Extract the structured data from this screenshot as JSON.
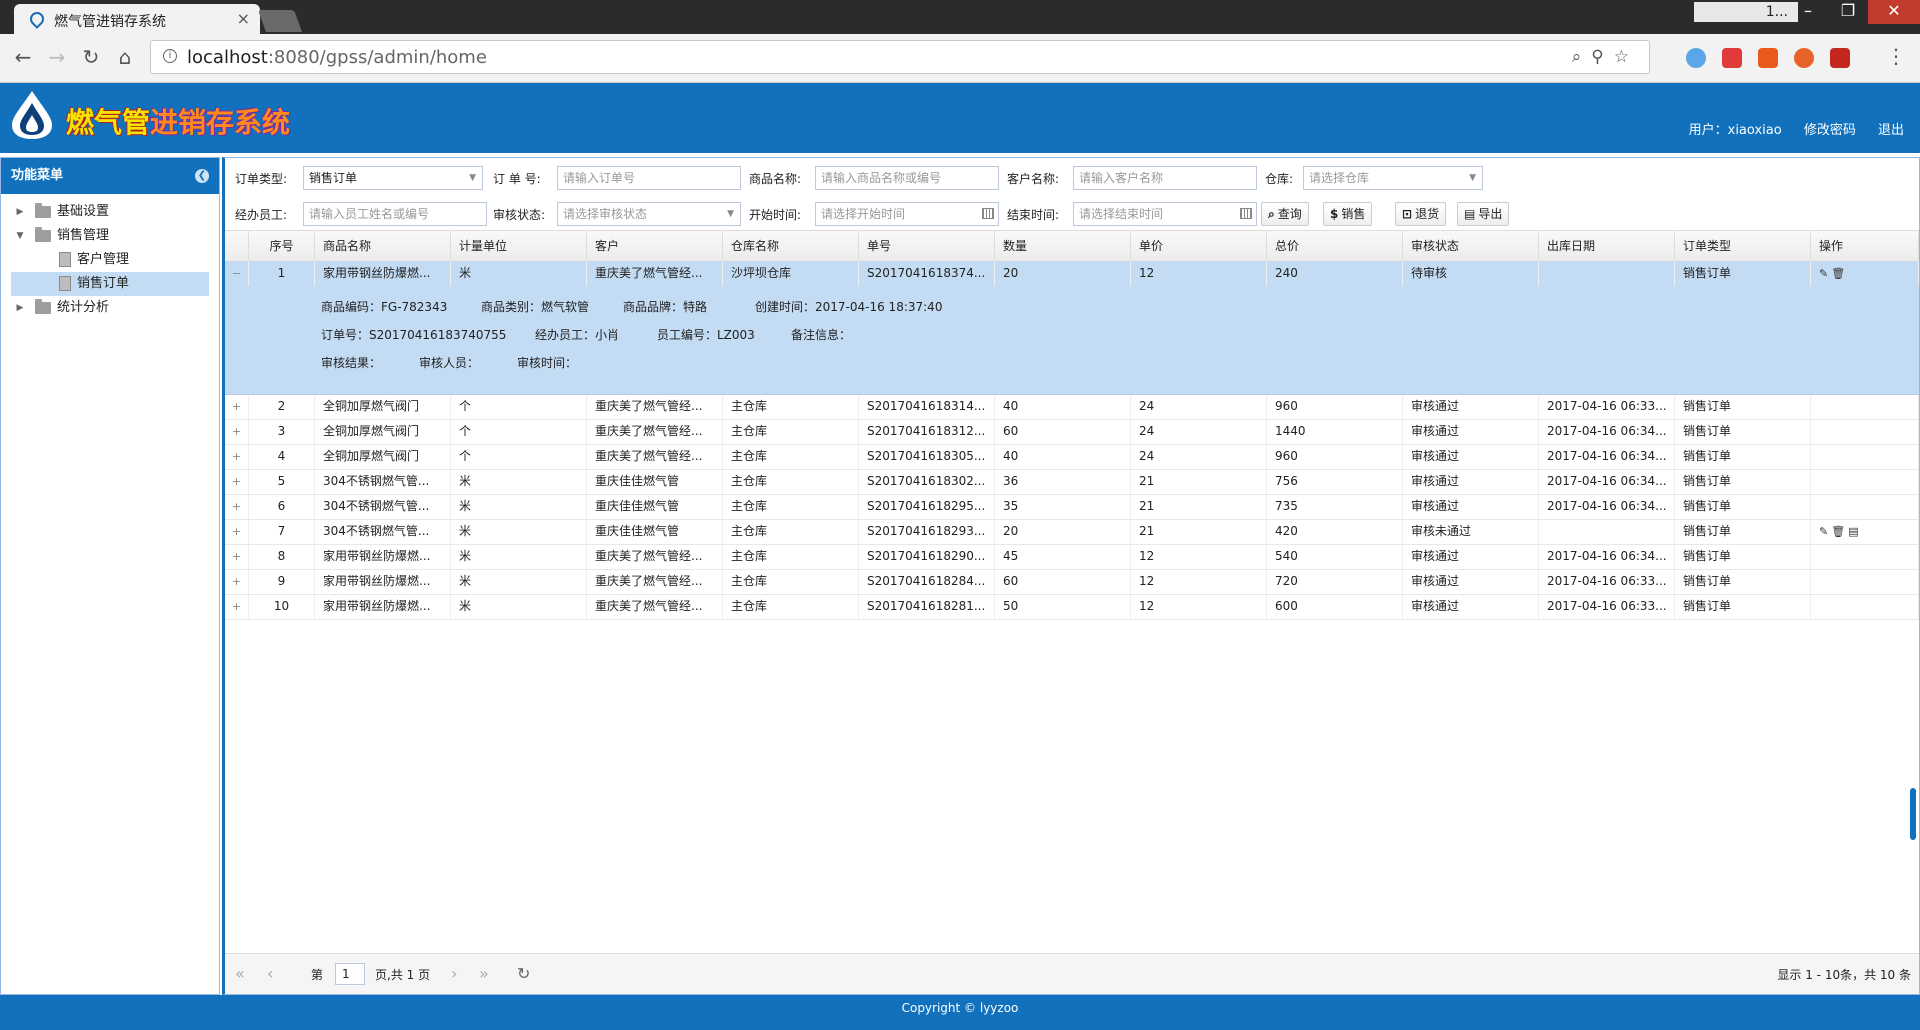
{
  "browser": {
    "tab_title": "燃气管进销存系统",
    "tab_close": "×",
    "window_name": "1...",
    "url_host": "localhost",
    "url_rest": ":8080/gpss/admin/home",
    "window_buttons": [
      "–",
      "❐",
      "✕"
    ]
  },
  "app": {
    "logo_part1": "燃气管",
    "logo_part2": "进销存系统",
    "user_label": "用户：xiaoxiao",
    "change_password": "修改密码",
    "logout": "退出"
  },
  "sidebar": {
    "title": "功能菜单",
    "items": [
      {
        "label": "基础设置"
      },
      {
        "label": "销售管理"
      },
      {
        "label": "客户管理"
      },
      {
        "label": "销售订单"
      },
      {
        "label": "统计分析"
      }
    ]
  },
  "filters": {
    "order_type_label": "订单类型:",
    "order_type_value": "销售订单",
    "order_no_label": "订 单 号:",
    "order_no_placeholder": "请输入订单号",
    "product_label": "商品名称:",
    "product_placeholder": "请输入商品名称或编号",
    "customer_label": "客户名称:",
    "customer_placeholder": "请输入客户名称",
    "warehouse_label": "仓库:",
    "warehouse_placeholder": "请选择仓库",
    "staff_label": "经办员工:",
    "staff_placeholder": "请输入员工姓名或编号",
    "audit_label": "审核状态:",
    "audit_placeholder": "请选择审核状态",
    "start_label": "开始时间:",
    "start_placeholder": "请选择开始时间",
    "end_label": "结束时间:",
    "end_placeholder": "请选择结束时间",
    "btn_query": "查询",
    "btn_sale": "销售",
    "btn_return": "退货",
    "btn_export": "导出"
  },
  "grid": {
    "columns": [
      "序号",
      "商品名称",
      "计量单位",
      "客户",
      "仓库名称",
      "单号",
      "数量",
      "单价",
      "总价",
      "审核状态",
      "出库日期",
      "订单类型",
      "操作"
    ],
    "rows": [
      {
        "exp": "−",
        "no": "1",
        "product": "家用带钢丝防爆燃...",
        "unit": "米",
        "customer": "重庆美了燃气管经...",
        "warehouse": "沙坪坝仓库",
        "order": "S2017041618374...",
        "qty": "20",
        "price": "12",
        "total": "240",
        "status": "待审核",
        "date": "",
        "type": "销售订单",
        "ops": "✎🗑"
      },
      {
        "exp": "+",
        "no": "2",
        "product": "全铜加厚燃气阀门",
        "unit": "个",
        "customer": "重庆美了燃气管经...",
        "warehouse": "主仓库",
        "order": "S2017041618314...",
        "qty": "40",
        "price": "24",
        "total": "960",
        "status": "审核通过",
        "date": "2017-04-16 06:33...",
        "type": "销售订单",
        "ops": ""
      },
      {
        "exp": "+",
        "no": "3",
        "product": "全铜加厚燃气阀门",
        "unit": "个",
        "customer": "重庆美了燃气管经...",
        "warehouse": "主仓库",
        "order": "S2017041618312...",
        "qty": "60",
        "price": "24",
        "total": "1440",
        "status": "审核通过",
        "date": "2017-04-16 06:34...",
        "type": "销售订单",
        "ops": ""
      },
      {
        "exp": "+",
        "no": "4",
        "product": "全铜加厚燃气阀门",
        "unit": "个",
        "customer": "重庆美了燃气管经...",
        "warehouse": "主仓库",
        "order": "S2017041618305...",
        "qty": "40",
        "price": "24",
        "total": "960",
        "status": "审核通过",
        "date": "2017-04-16 06:34...",
        "type": "销售订单",
        "ops": ""
      },
      {
        "exp": "+",
        "no": "5",
        "product": "304不锈钢燃气管...",
        "unit": "米",
        "customer": "重庆佳佳燃气管",
        "warehouse": "主仓库",
        "order": "S2017041618302...",
        "qty": "36",
        "price": "21",
        "total": "756",
        "status": "审核通过",
        "date": "2017-04-16 06:34...",
        "type": "销售订单",
        "ops": ""
      },
      {
        "exp": "+",
        "no": "6",
        "product": "304不锈钢燃气管...",
        "unit": "米",
        "customer": "重庆佳佳燃气管",
        "warehouse": "主仓库",
        "order": "S2017041618295...",
        "qty": "35",
        "price": "21",
        "total": "735",
        "status": "审核通过",
        "date": "2017-04-16 06:34...",
        "type": "销售订单",
        "ops": ""
      },
      {
        "exp": "+",
        "no": "7",
        "product": "304不锈钢燃气管...",
        "unit": "米",
        "customer": "重庆佳佳燃气管",
        "warehouse": "主仓库",
        "order": "S2017041618293...",
        "qty": "20",
        "price": "21",
        "total": "420",
        "status": "审核未通过",
        "date": "",
        "type": "销售订单",
        "ops": "✎🗑▤"
      },
      {
        "exp": "+",
        "no": "8",
        "product": "家用带钢丝防爆燃...",
        "unit": "米",
        "customer": "重庆美了燃气管经...",
        "warehouse": "主仓库",
        "order": "S2017041618290...",
        "qty": "45",
        "price": "12",
        "total": "540",
        "status": "审核通过",
        "date": "2017-04-16 06:34...",
        "type": "销售订单",
        "ops": ""
      },
      {
        "exp": "+",
        "no": "9",
        "product": "家用带钢丝防爆燃...",
        "unit": "米",
        "customer": "重庆美了燃气管经...",
        "warehouse": "主仓库",
        "order": "S2017041618284...",
        "qty": "60",
        "price": "12",
        "total": "720",
        "status": "审核通过",
        "date": "2017-04-16 06:33...",
        "type": "销售订单",
        "ops": ""
      },
      {
        "exp": "+",
        "no": "10",
        "product": "家用带钢丝防爆燃...",
        "unit": "米",
        "customer": "重庆美了燃气管经...",
        "warehouse": "主仓库",
        "order": "S2017041618281...",
        "qty": "50",
        "price": "12",
        "total": "600",
        "status": "审核通过",
        "date": "2017-04-16 06:33...",
        "type": "销售订单",
        "ops": ""
      }
    ],
    "detail": {
      "product_code": "商品编码：FG-782343",
      "product_category": "商品类别：燃气软管",
      "product_brand": "商品品牌：特路",
      "created": "创建时间：2017-04-16 18:37:40",
      "order_no": "订单号：S20170416183740755",
      "staff": "经办员工：小肖",
      "staff_no": "员工编号：LZ003",
      "remark": "备注信息：",
      "audit_result": "审核结果：",
      "auditor": "审核人员：",
      "audit_time": "审核时间："
    }
  },
  "pager": {
    "page_label": "第",
    "page_value": "1",
    "page_total": "页,共 1 页",
    "summary": "显示 1 - 10条，共 10 条"
  },
  "footer": {
    "copyright": "Copyright © lyyzoo"
  },
  "colors": {
    "brand_blue": "#1171bd",
    "selected_row": "#c3dcf3"
  }
}
